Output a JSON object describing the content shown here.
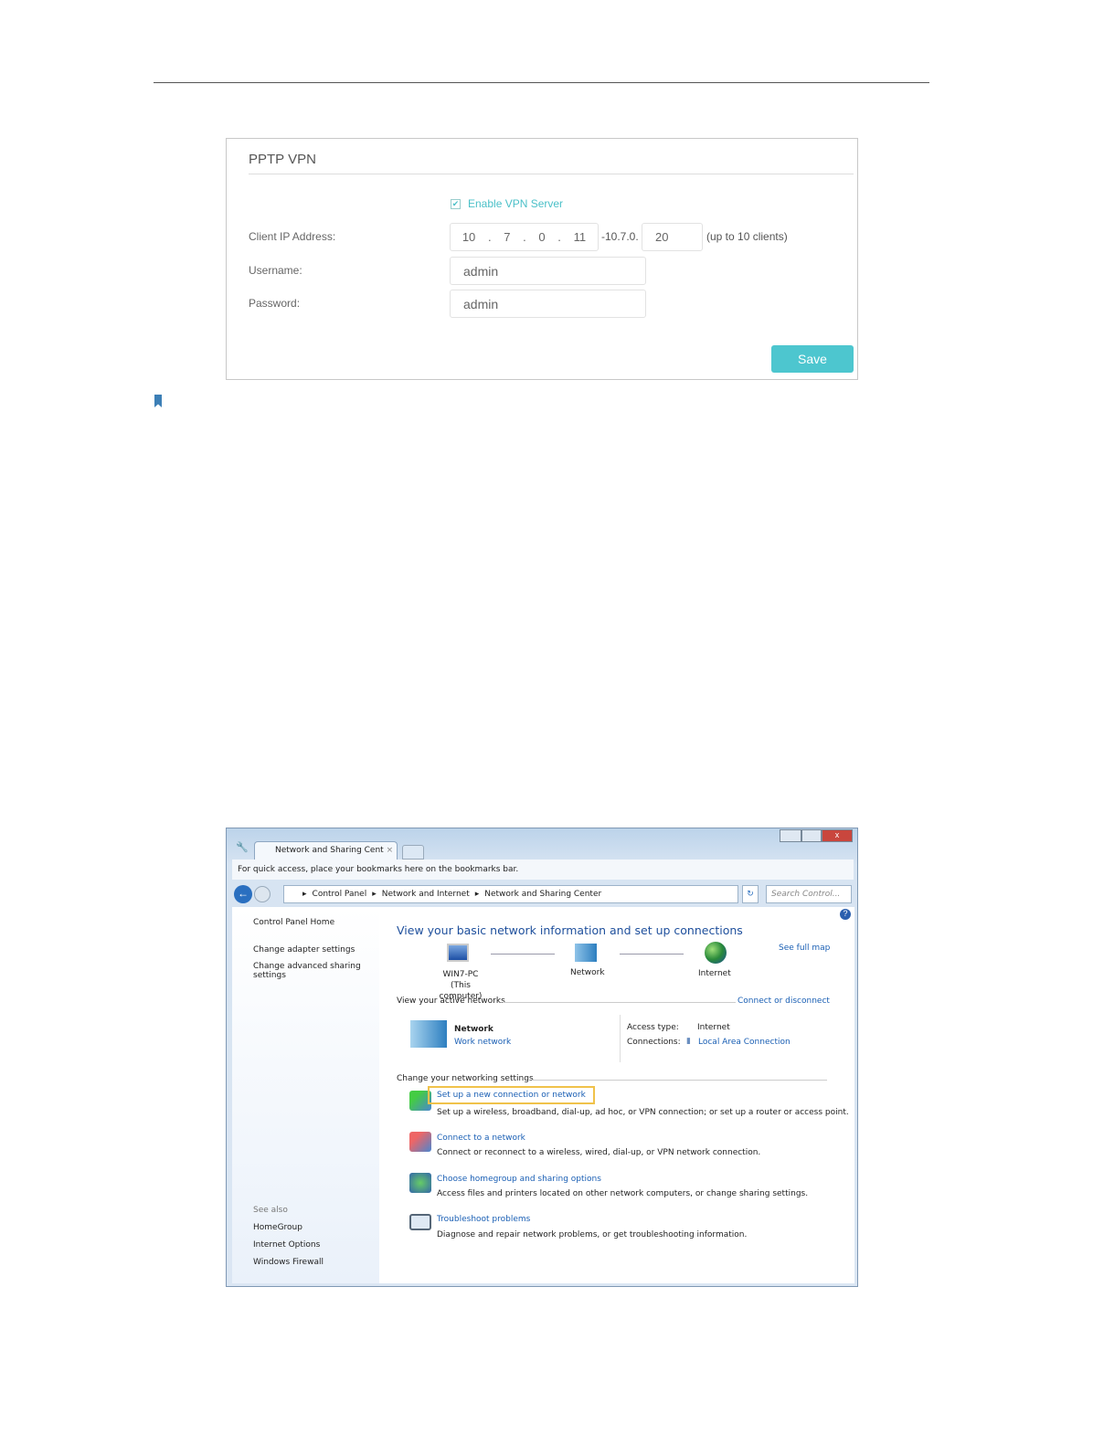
{
  "vpn_panel": {
    "title": "PPTP VPN",
    "enable_label": "Enable VPN Server",
    "enable_checked": true,
    "client_ip_label": "Client IP Address:",
    "ip_octets": [
      "10",
      "7",
      "0",
      "11"
    ],
    "ip_range_prefix": "-10.7.0.",
    "ip_range_end": "20",
    "ip_hint": "(up to 10 clients)",
    "username_label": "Username:",
    "username_value": "admin",
    "password_label": "Password:",
    "password_value": "admin",
    "save_label": "Save",
    "accent": "#4dc6cf"
  },
  "window": {
    "tab_title": "Network and Sharing Cent",
    "bookmarks_bar": "For quick access, place your bookmarks here on the bookmarks bar.",
    "breadcrumb": [
      "Control Panel",
      "Network and Internet",
      "Network and Sharing Center"
    ],
    "search_placeholder": "Search Control...",
    "sidebar": {
      "items": [
        "Control Panel Home",
        "Change adapter settings",
        "Change advanced sharing settings"
      ],
      "see_also_label": "See also",
      "see_also": [
        "HomeGroup",
        "Internet Options",
        "Windows Firewall"
      ]
    },
    "main": {
      "heading": "View your basic network information and set up connections",
      "see_full_map": "See full map",
      "map": {
        "computer": "WIN7-PC",
        "computer_sub": "(This computer)",
        "network": "Network",
        "internet": "Internet"
      },
      "active_label": "View your active networks",
      "connect_disconnect": "Connect or disconnect",
      "network_name": "Network",
      "network_type": "Work network",
      "access_type_label": "Access type:",
      "access_type_value": "Internet",
      "connections_label": "Connections:",
      "connections_value": "Local Area Connection",
      "change_label": "Change your networking settings",
      "tasks": [
        {
          "title": "Set up a new connection or network",
          "desc": "Set up a wireless, broadband, dial-up, ad hoc, or VPN connection; or set up a router or access point.",
          "highlighted": true
        },
        {
          "title": "Connect to a network",
          "desc": "Connect or reconnect to a wireless, wired, dial-up, or VPN network connection."
        },
        {
          "title": "Choose homegroup and sharing options",
          "desc": "Access files and printers located on other network computers, or change sharing settings."
        },
        {
          "title": "Troubleshoot problems",
          "desc": "Diagnose and repair network problems, or get troubleshooting information."
        }
      ]
    }
  }
}
